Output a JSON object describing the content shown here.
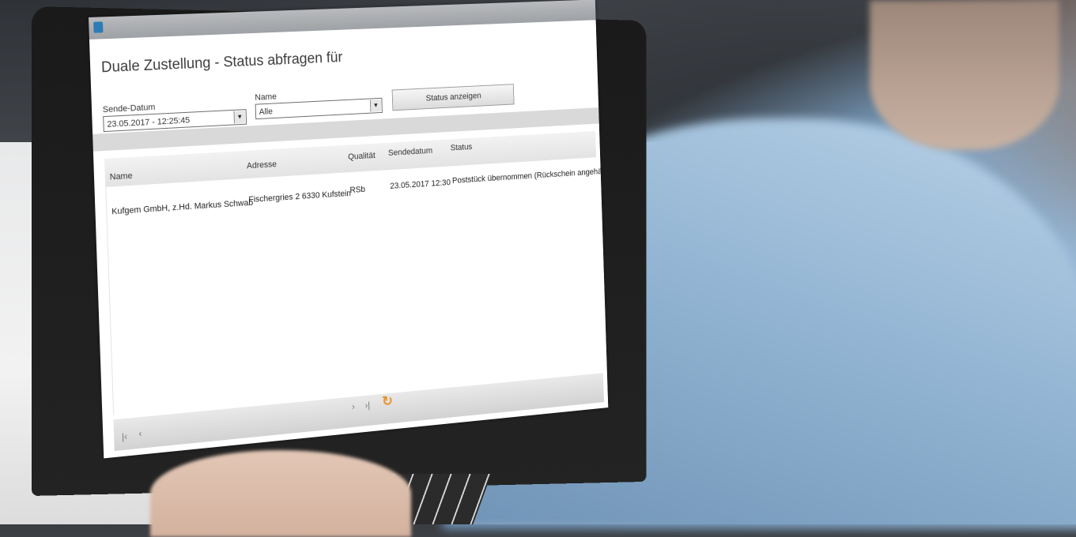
{
  "form": {
    "title": "Duale Zustellung - Status abfragen für",
    "send_date_label": "Sende-Datum",
    "send_date_value": "23.05.2017 - 12:25:45",
    "name_label": "Name",
    "name_value": "Alle",
    "status_button": "Status anzeigen"
  },
  "table": {
    "columns": [
      "Name",
      "Adresse",
      "Qualität",
      "Sendedatum",
      "Status"
    ],
    "rows": [
      {
        "name": "Kufgem GmbH, z.Hd. Markus Schwab",
        "address": "Fischergries 2 6330 Kufstein",
        "quality": "RSb",
        "send_date": "23.05.2017 12:30",
        "status": "Poststück übernommen (Rückschein angehängt)"
      }
    ]
  },
  "pager": {
    "first": "|‹",
    "prev": "‹",
    "next": "›",
    "last": "›|"
  },
  "icons": {
    "app": "app-logo-icon",
    "busy": "loading-spinner-icon"
  },
  "colors": {
    "accent_busy": "#e8942b",
    "app_icon": "#2d7db5"
  }
}
